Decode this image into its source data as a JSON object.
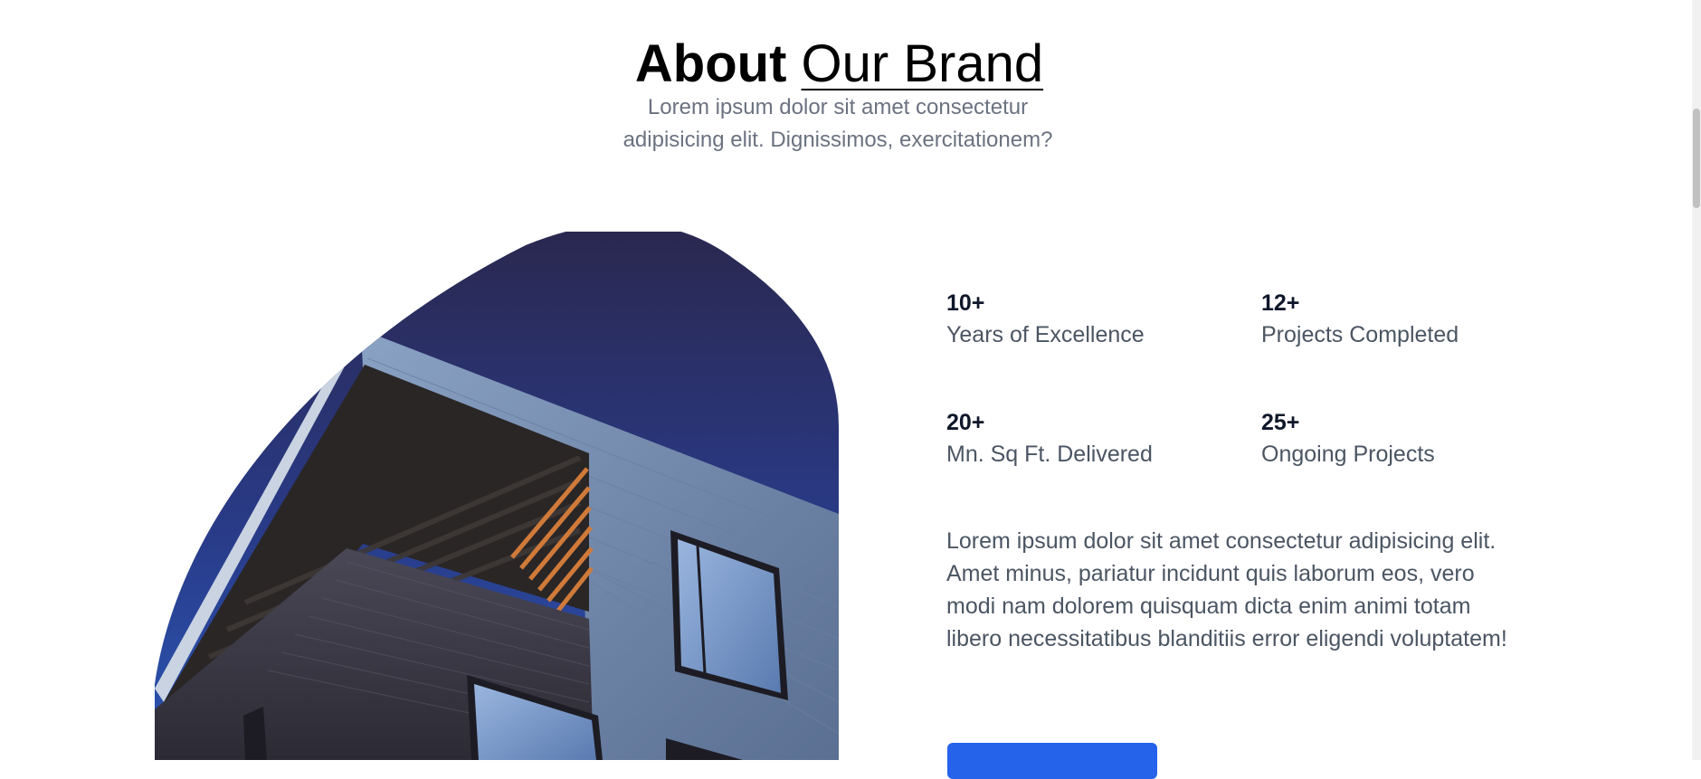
{
  "header": {
    "title_bold": "About",
    "title_link": "Our Brand",
    "subtitle": "Lorem ipsum dolor sit amet consectetur adipisicing elit. Dignissimos, exercitationem?"
  },
  "stats": [
    {
      "value": "10+",
      "label": "Years of Excellence"
    },
    {
      "value": "12+",
      "label": "Projects Completed"
    },
    {
      "value": "20+",
      "label": "Mn. Sq Ft. Delivered"
    },
    {
      "value": "25+",
      "label": "Ongoing Projects"
    }
  ],
  "description": "Lorem ipsum dolor sit amet consectetur adipisicing elit. Amet minus, pariatur incidunt quis laborum eos, vero modi nam dolorem quisquam dicta enim animi totam libero necessitatibus blanditiis error eligendi voluptatem!",
  "cta": {
    "label": ""
  },
  "colors": {
    "accent": "#2563eb",
    "sky_top": "#2a2850",
    "sky_bottom": "#2a56b5",
    "text_muted": "#4b5563"
  },
  "image": {
    "subject": "modern-building-corner"
  }
}
